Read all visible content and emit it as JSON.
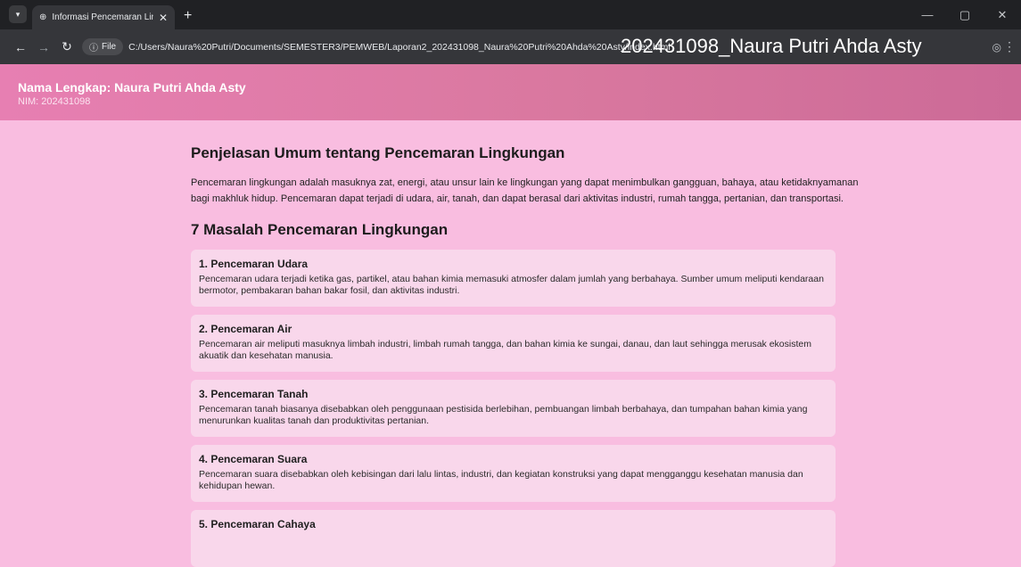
{
  "browser": {
    "tab_title": "Informasi Pencemaran Lingkun",
    "file_chip": "File",
    "url": "C:/Users/Naura%20Putri/Documents/SEMESTER3/PEMWEB/Laporan2_202431098_Naura%20Putri%20Ahda%20Asty/index.html",
    "overlay_text": "202431098_Naura Putri Ahda Asty"
  },
  "header": {
    "name": "Nama Lengkap: Naura Putri Ahda Asty",
    "nim": "NIM: 202431098"
  },
  "main": {
    "section_title": "Penjelasan Umum tentang Pencemaran Lingkungan",
    "intro": "Pencemaran lingkungan adalah masuknya zat, energi, atau unsur lain ke lingkungan yang dapat menimbulkan gangguan, bahaya, atau ketidaknyamanan bagi makhluk hidup. Pencemaran dapat terjadi di udara, air, tanah, dan dapat berasal dari aktivitas industri, rumah tangga, pertanian, dan transportasi.",
    "list_title": "7 Masalah Pencemaran Lingkungan",
    "items": [
      {
        "title": "1. Pencemaran Udara",
        "desc": "Pencemaran udara terjadi ketika gas, partikel, atau bahan kimia memasuki atmosfer dalam jumlah yang berbahaya. Sumber umum meliputi kendaraan bermotor, pembakaran bahan bakar fosil, dan aktivitas industri."
      },
      {
        "title": "2. Pencemaran Air",
        "desc": "Pencemaran air meliputi masuknya limbah industri, limbah rumah tangga, dan bahan kimia ke sungai, danau, dan laut sehingga merusak ekosistem akuatik dan kesehatan manusia."
      },
      {
        "title": "3. Pencemaran Tanah",
        "desc": "Pencemaran tanah biasanya disebabkan oleh penggunaan pestisida berlebihan, pembuangan limbah berbahaya, dan tumpahan bahan kimia yang menurunkan kualitas tanah dan produktivitas pertanian."
      },
      {
        "title": "4. Pencemaran Suara",
        "desc": "Pencemaran suara disebabkan oleh kebisingan dari lalu lintas, industri, dan kegiatan konstruksi yang dapat mengganggu kesehatan manusia dan kehidupan hewan."
      },
      {
        "title": "5. Pencemaran Cahaya",
        "desc": ""
      }
    ]
  }
}
